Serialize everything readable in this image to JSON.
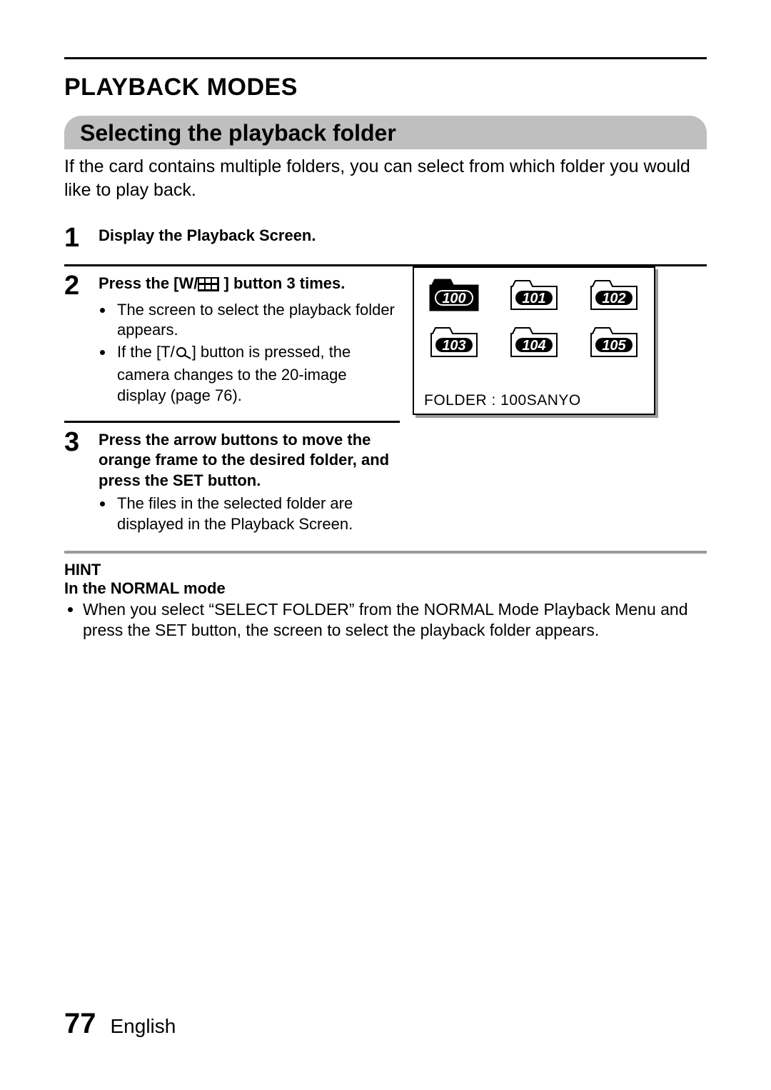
{
  "title": "PLAYBACK MODES",
  "section_heading": "Selecting the playback folder",
  "intro": "If the card contains multiple folders, you can select from which folder you would like to play back.",
  "steps": [
    {
      "num": "1",
      "head": "Display the Playback Screen.",
      "bullets": []
    },
    {
      "num": "2",
      "head_before": "Press the [W/",
      "head_after": "] button 3 times.",
      "bullets": [
        "The screen to select the playback folder appears.",
        {
          "before": "If the [T/",
          "after": "] button is pressed, the camera changes to the 20-image display  (page 76)."
        }
      ]
    },
    {
      "num": "3",
      "head": "Press the arrow buttons to move the orange frame to the desired folder, and press the SET button.",
      "bullets": [
        "The files in the selected folder are displayed in the Playback Screen."
      ]
    }
  ],
  "screen": {
    "folders": [
      "100",
      "101",
      "102",
      "103",
      "104",
      "105"
    ],
    "selected_index": 0,
    "caption": "FOLDER : 100SANYO"
  },
  "hint": {
    "title": "HINT",
    "subtitle": "In the NORMAL mode",
    "bullet": "When you select “SELECT FOLDER” from the NORMAL Mode Playback Menu and press the SET button, the screen to select the playback folder appears."
  },
  "footer": {
    "page": "77",
    "language": "English"
  }
}
